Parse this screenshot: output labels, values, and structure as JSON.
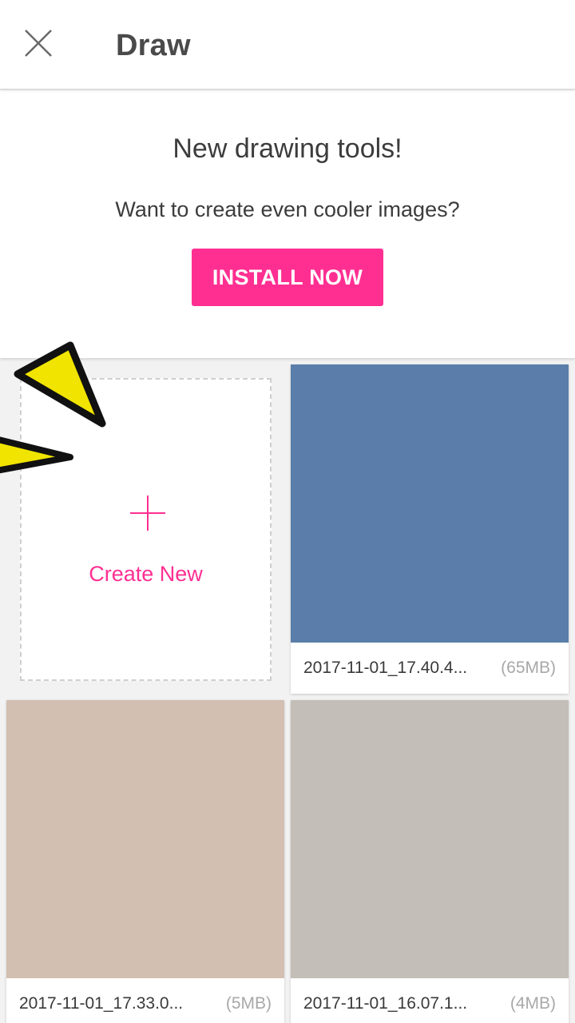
{
  "header": {
    "title": "Draw",
    "close_icon": "close-icon"
  },
  "promo": {
    "heading": "New drawing tools!",
    "subtitle": "Want to create even cooler images?",
    "install_label": "INSTALL NOW",
    "accent_color": "#ff2f92"
  },
  "create": {
    "label": "Create New",
    "icon": "plus-icon"
  },
  "drawings": [
    {
      "name": "2017-11-01_17.40.4...",
      "size": "(65MB)",
      "color": "#5a7ea9"
    },
    {
      "name": "2017-11-01_17.33.0...",
      "size": "(5MB)",
      "color": "#d2bfb2"
    },
    {
      "name": "2017-11-01_16.07.1...",
      "size": "(4MB)",
      "color": "#c3beb8"
    }
  ]
}
